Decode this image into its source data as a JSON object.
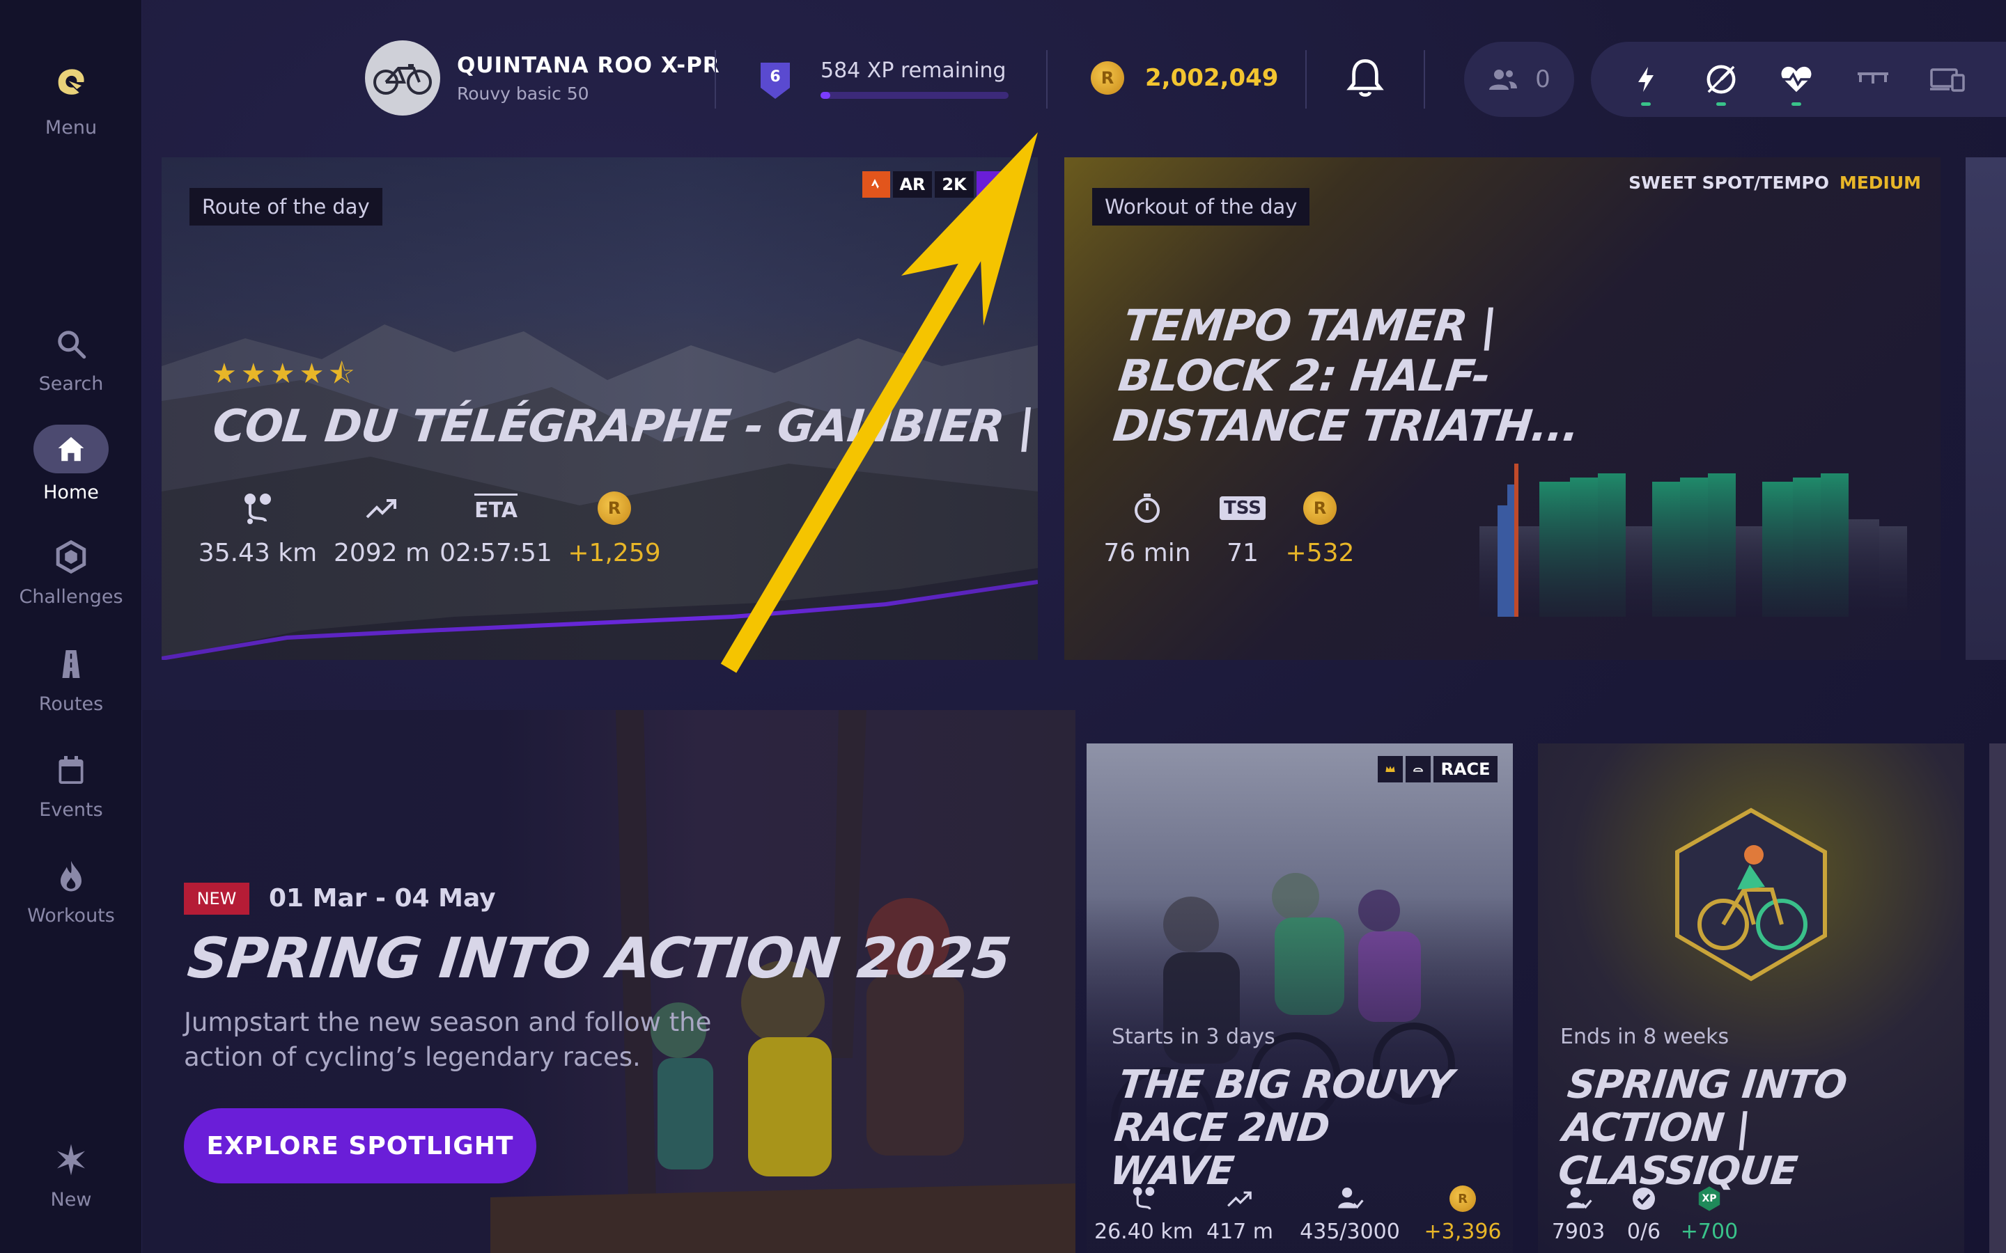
{
  "sidebar": {
    "menu_label": "Menu",
    "items": [
      {
        "label": "Search",
        "icon": "search-icon"
      },
      {
        "label": "Home",
        "icon": "home-icon",
        "active": true
      },
      {
        "label": "Challenges",
        "icon": "hexagon-icon"
      },
      {
        "label": "Routes",
        "icon": "routes-icon"
      },
      {
        "label": "Events",
        "icon": "calendar-icon"
      },
      {
        "label": "Workouts",
        "icon": "flame-icon"
      }
    ],
    "new_label": "New"
  },
  "topbar": {
    "bike_name": "QUINTANA ROO X-PR",
    "bike_sub": "Rouvy basic 50",
    "level": "6",
    "xp_text": "584 XP remaining",
    "xp_progress": 0.05,
    "coins": "2,002,049",
    "friends_count": "0",
    "coin_symbol": "R"
  },
  "route_card": {
    "chip": "Route of the day",
    "tags": [
      "AR",
      "2K"
    ],
    "stars": "★★★★⯪",
    "title": "COL DU TÉLÉGRAPHE - GALIBIER |  FRANCE",
    "stats": {
      "distance": "35.43 km",
      "elevation": "2092 m",
      "eta_label": "ETA",
      "eta": "02:57:51",
      "coins": "+1,259"
    }
  },
  "workout_card": {
    "chip": "Workout of the day",
    "category": "SWEET SPOT/TEMPO",
    "difficulty": "MEDIUM",
    "title_lines": [
      "TEMPO TAMER |",
      "BLOCK 2: HALF-",
      "DISTANCE TRIATH..."
    ],
    "stats": {
      "duration": "76 min",
      "tss_label": "TSS",
      "tss": "71",
      "coins": "+532"
    }
  },
  "spotlight": {
    "badge": "NEW",
    "date_range": "01 Mar - 04 May",
    "title": "SPRING INTO ACTION 2025",
    "description": "Jumpstart the new season and follow the action of cycling’s legendary races.",
    "button": "EXPLORE SPOTLIGHT"
  },
  "event_card": {
    "tag": "RACE",
    "status": "Starts in 3 days",
    "title_lines": [
      "THE BIG ROUVY RACE 2ND",
      "WAVE"
    ],
    "stats": {
      "distance": "26.40 km",
      "elevation": "417 m",
      "participants": "435/3000",
      "coins": "+3,396"
    }
  },
  "challenge_card": {
    "status": "Ends in 8 weeks",
    "title_lines": [
      "SPRING INTO ACTION |",
      "CLASSIQUE"
    ],
    "stats": {
      "participants": "7903",
      "progress": "0/6",
      "xp": "+700",
      "xp_label": "XP"
    }
  },
  "colors": {
    "accent": "#6a1ed8",
    "gold": "#e8b628",
    "annotation_arrow": "#f5c400"
  }
}
